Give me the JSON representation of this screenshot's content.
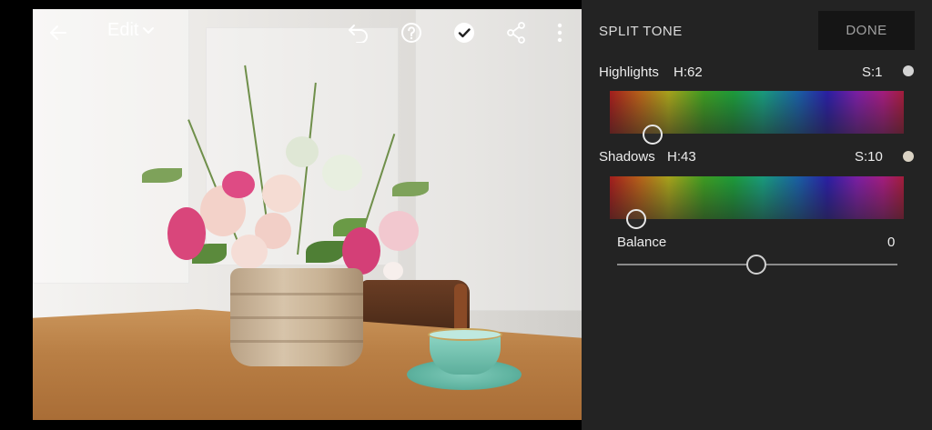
{
  "toolbar": {
    "edit_label": "Edit"
  },
  "panel": {
    "title": "SPLIT TONE",
    "done_label": "DONE",
    "highlights": {
      "label": "Highlights",
      "hue": "H:62",
      "saturation": "S:1",
      "dot_color": "#d3d3d3"
    },
    "shadows": {
      "label": "Shadows",
      "hue": "H:43",
      "saturation": "S:10",
      "dot_color": "#d9d2c3"
    },
    "balance": {
      "label": "Balance",
      "value": "0"
    }
  },
  "icons": {
    "back": "back-arrow-icon",
    "edit_dropdown": "chevron-down-icon",
    "undo": "undo-icon",
    "help": "help-icon",
    "apply": "check-icon",
    "share": "share-icon",
    "more": "more-vertical-icon"
  },
  "colors": {
    "panel_bg": "#232323",
    "done_bg": "#151515"
  }
}
